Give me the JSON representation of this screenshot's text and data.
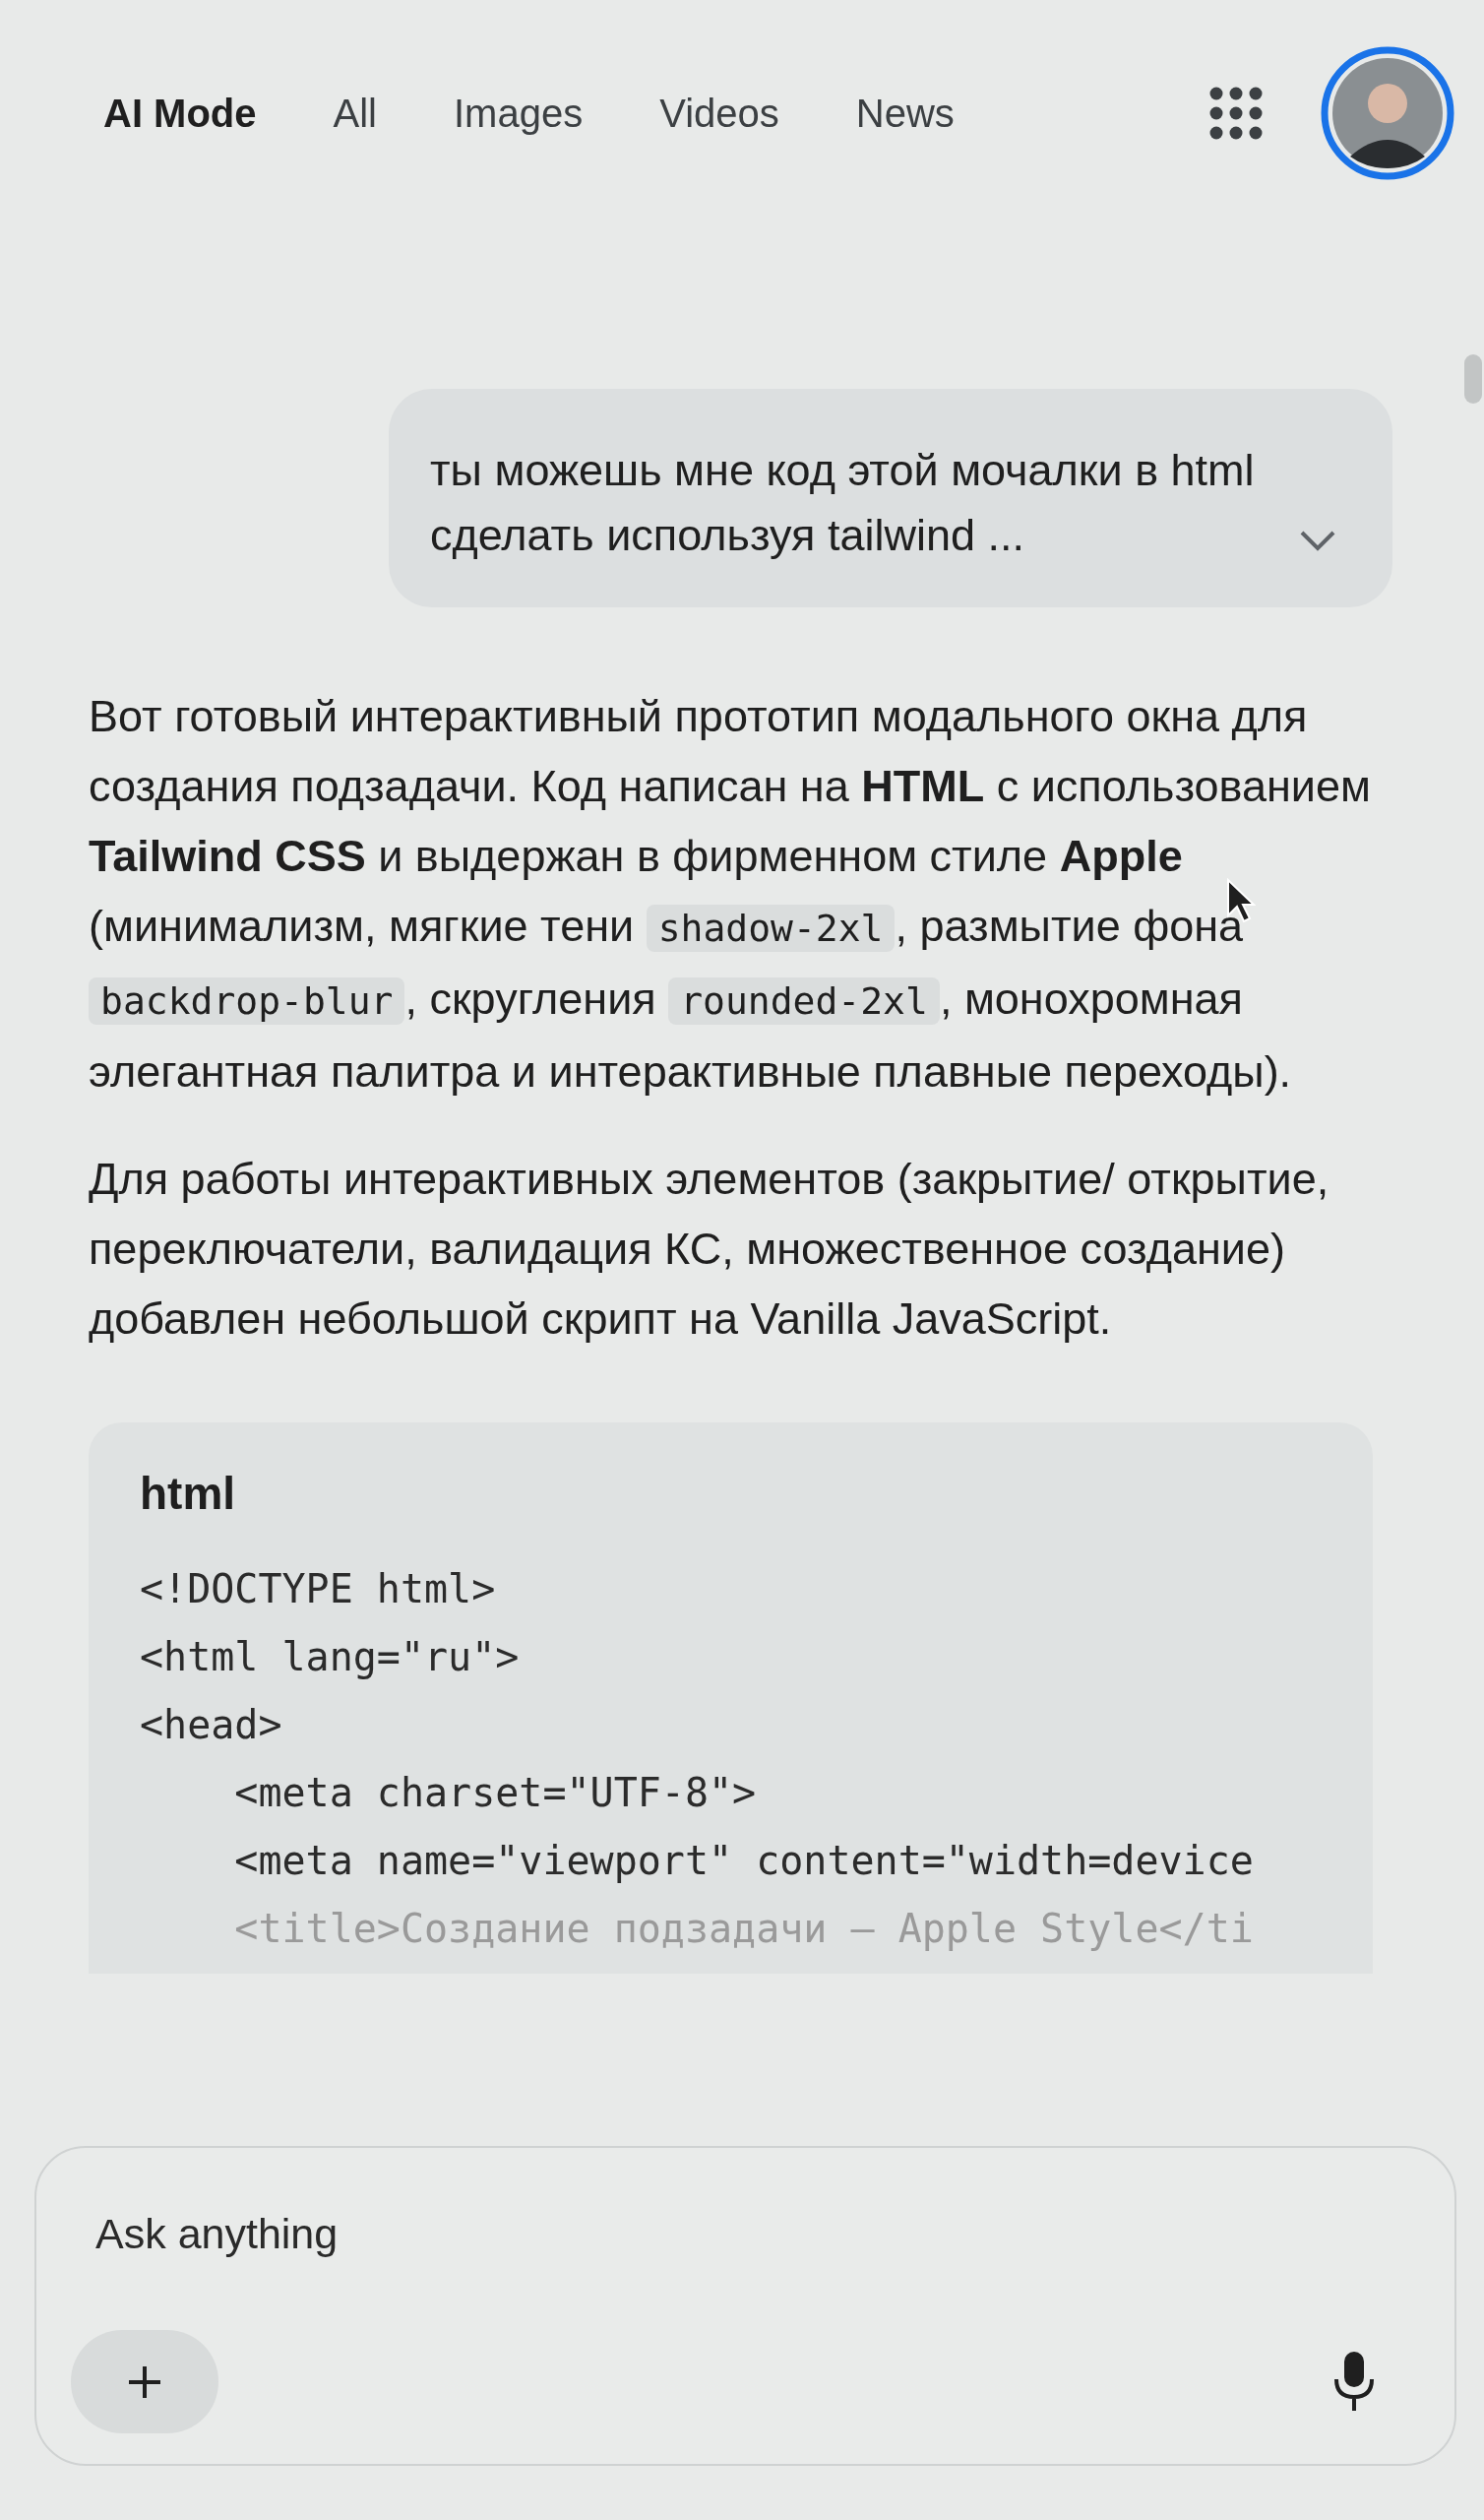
{
  "tabs": [
    {
      "label": "AI Mode",
      "selected": true
    },
    {
      "label": "All",
      "selected": false
    },
    {
      "label": "Images",
      "selected": false
    },
    {
      "label": "Videos",
      "selected": false
    },
    {
      "label": "News",
      "selected": false
    }
  ],
  "user_message": {
    "text": "ты можешь мне код этой мочалки в html сделать используя tailwind ...",
    "expanded": false
  },
  "answer": [
    [
      {
        "kind": "text",
        "text": "Вот готовый интерактивный прототип модального окна для создания подзадачи. Код написан на **HTML** с использованием **Tailwind CSS** и выдержан в фирменном стиле **Apple** (минимализм, мягкие тени "
      },
      {
        "kind": "code",
        "text": "shadow-2xl"
      },
      {
        "kind": "text",
        "text": ", размытие фона "
      },
      {
        "kind": "code",
        "text": "backdrop-blur"
      },
      {
        "kind": "text",
        "text": ", скругления "
      },
      {
        "kind": "code",
        "text": "rounded-2xl"
      },
      {
        "kind": "text",
        "text": ", монохромная элегантная палитра и интерактивные плавные переходы)."
      }
    ],
    [
      {
        "kind": "text",
        "text": "Для работы интерактивных элементов (закрытие/ открытие, переключатели, валидация КС, множественное создание) добавлен небольшой скрипт на Vanilla JavaScript."
      }
    ]
  ],
  "code_block": {
    "language": "html",
    "lines": [
      {
        "text": "<!DOCTYPE html>",
        "faded": false
      },
      {
        "text": "<html lang=\"ru\">",
        "faded": false
      },
      {
        "text": "<head>",
        "faded": false
      },
      {
        "text": "    <meta charset=\"UTF-8\">",
        "faded": false
      },
      {
        "text": "    <meta name=\"viewport\" content=\"width=device",
        "faded": false
      },
      {
        "text": "    <title>Создание подзадачи – Apple Style</ti",
        "faded": true
      }
    ]
  },
  "composer": {
    "placeholder": "Ask anything"
  }
}
